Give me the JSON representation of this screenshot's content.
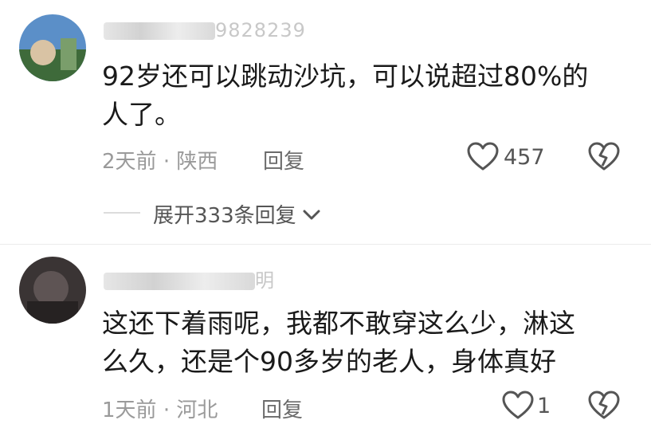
{
  "comments": [
    {
      "username_visible": "9828239",
      "text_line1": "92岁还可以跳动沙坑，可以说超过80%的",
      "text_line2": "人了。",
      "time": "2天前",
      "separator": "·",
      "location": "陕西",
      "reply_label": "回复",
      "like_count": "457",
      "expand_label": "展开333条回复"
    },
    {
      "username_visible": "明",
      "text_line1": "这还下着雨呢，我都不敢穿这么少，淋这",
      "text_line2": "么久，还是个90多岁的老人，身体真好",
      "time": "1天前",
      "separator": "·",
      "location": "河北",
      "reply_label": "回复",
      "like_count": "1"
    }
  ],
  "icons": {
    "like": "heart-outline-icon",
    "dislike": "broken-heart-icon",
    "expand": "chevron-down-icon"
  }
}
